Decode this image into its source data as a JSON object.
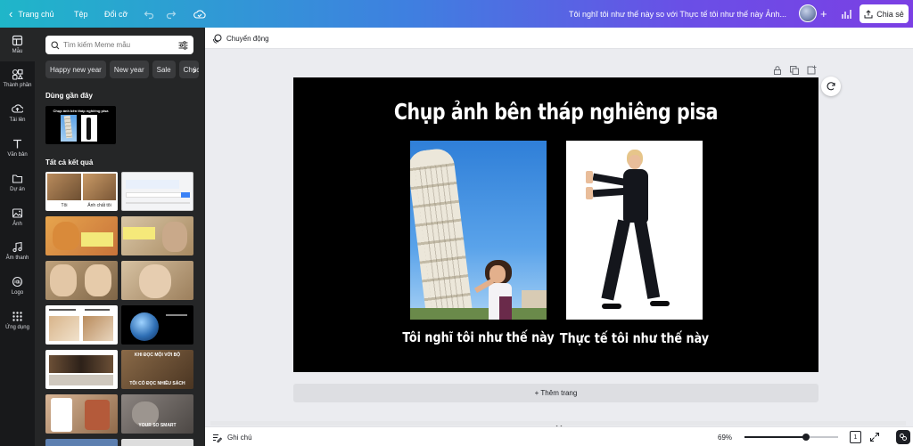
{
  "topbar": {
    "home_label": "Trang chủ",
    "file_label": "Tệp",
    "resize_label": "Đổi cỡ",
    "doc_title": "Tôi nghĩ tôi như thế này so với Thực tế tôi như thế này Ảnh...",
    "share_label": "Chia sẻ"
  },
  "rail": {
    "items": [
      {
        "label": "Mẫu",
        "icon": "template-icon"
      },
      {
        "label": "Thành phần",
        "icon": "elements-icon"
      },
      {
        "label": "Tải lên",
        "icon": "upload-icon"
      },
      {
        "label": "Văn bản",
        "icon": "text-icon"
      },
      {
        "label": "Dự án",
        "icon": "folder-icon"
      },
      {
        "label": "Ảnh",
        "icon": "photo-icon"
      },
      {
        "label": "Âm thanh",
        "icon": "music-icon"
      },
      {
        "label": "Logo",
        "icon": "logo-icon"
      },
      {
        "label": "Ứng dụng",
        "icon": "apps-icon"
      }
    ]
  },
  "panel": {
    "search_placeholder": "Tìm kiếm Meme mẫu",
    "chips": [
      "Happy new year",
      "New year",
      "Sale",
      "Chúc"
    ],
    "recent_title": "Dùng gần đây",
    "recent_thumb_caption": "Chụp ảnh bên tháp nghiêng pisa",
    "all_title": "Tất cả kết quả",
    "result_texts": [
      "Tôi",
      "Ảnh chất tôi",
      "",
      "",
      "",
      "",
      "",
      "",
      "",
      "",
      "",
      "",
      "",
      "",
      "",
      "KHI ĐỌC MỘI VỚI BỘ",
      "",
      "TÔI CÓ ĐỌC NHIỀU SÁCH",
      "",
      "YOUR SO SMART",
      "",
      ""
    ]
  },
  "canvas_toolbar": {
    "animate_label": "Chuyển động"
  },
  "page": {
    "title": "Chụp ảnh bên tháp nghiêng pisa",
    "left_caption": "Tôi nghĩ tôi như thế này",
    "right_caption": "Thực tế tôi như thế này"
  },
  "add_page_label": "+ Thêm trang",
  "bottombar": {
    "notes_label": "Ghi chú",
    "zoom": "69%",
    "page_count": "1",
    "zoom_fraction": 0.69
  },
  "colors": {
    "accent": "#7b3fe4",
    "panel": "#252627",
    "rail": "#18191b"
  }
}
